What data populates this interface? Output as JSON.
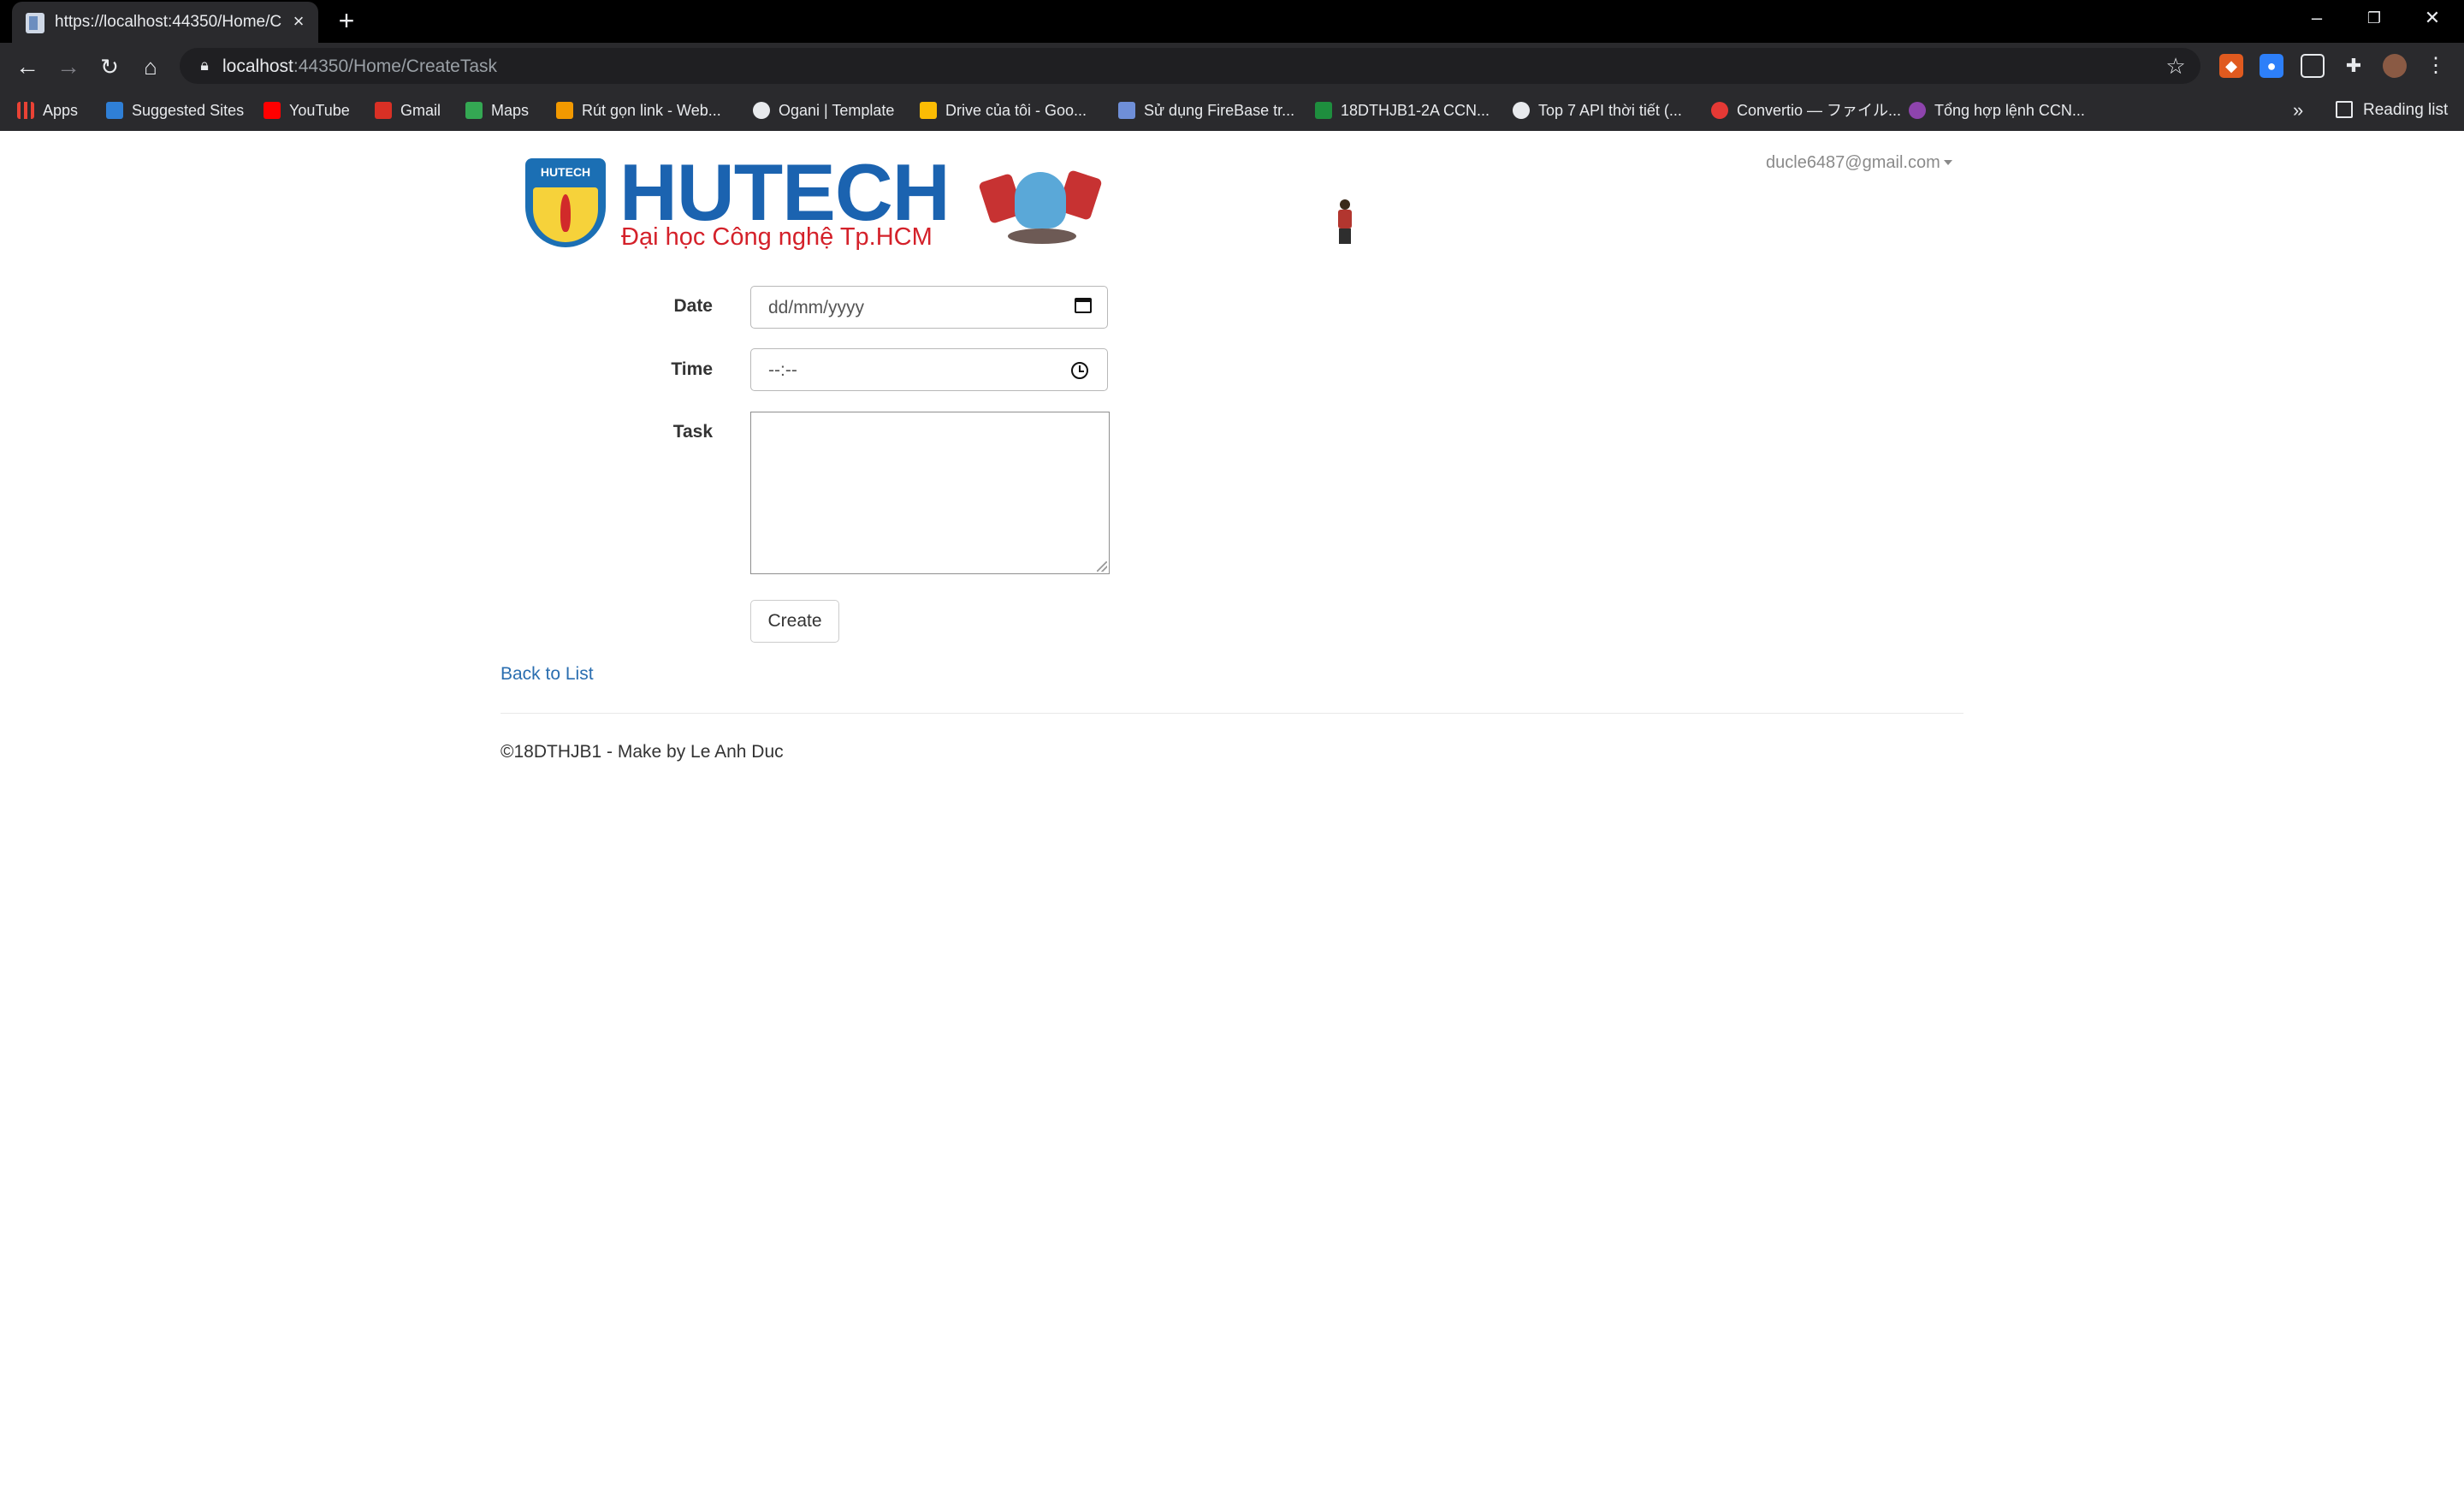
{
  "browser": {
    "tab_title": "https://localhost:44350/Home/C",
    "url_host": "localhost",
    "url_rest": ":44350/Home/CreateTask",
    "bookmarks": [
      {
        "label": "Apps",
        "icon": "apps-grid-icon",
        "color": "#e94235"
      },
      {
        "label": "Suggested Sites",
        "icon": "bing-icon",
        "color": "#2f7fd6"
      },
      {
        "label": "YouTube",
        "icon": "youtube-icon",
        "color": "#ff0000"
      },
      {
        "label": "Gmail",
        "icon": "gmail-icon",
        "color": "#d93025"
      },
      {
        "label": "Maps",
        "icon": "maps-icon",
        "color": "#34a853"
      },
      {
        "label": "Rút gọn link - Web...",
        "icon": "v-shield-icon",
        "color": "#f29900"
      },
      {
        "label": "Ogani | Template",
        "icon": "globe-icon",
        "color": "#e8eaed"
      },
      {
        "label": "Drive của tôi - Goo...",
        "icon": "drive-icon",
        "color": "#fbbc04"
      },
      {
        "label": "Sử dụng FireBase tr...",
        "icon": "y-icon",
        "color": "#6f8fd8"
      },
      {
        "label": "18DTHJB1-2A CCN...",
        "icon": "classroom-icon",
        "color": "#1e8e3e"
      },
      {
        "label": "Top 7 API thời tiết (...",
        "icon": "clock-logo-icon",
        "color": "#e8eaed"
      },
      {
        "label": "Convertio — ファイル...",
        "icon": "convertio-icon",
        "color": "#e53935"
      },
      {
        "label": "Tổng hợp lệnh CCN...",
        "icon": "purple-circle-icon",
        "color": "#8e44ad"
      }
    ],
    "more_label": "»",
    "reading_list_label": "Reading list"
  },
  "header": {
    "brand_shield_text": "HUTECH",
    "brand_name": "HUTECH",
    "brand_subtitle": "Đại học Công nghệ Tp.HCM",
    "user_email": "ducle6487@gmail.com"
  },
  "form": {
    "date_label": "Date",
    "date_placeholder": "dd/mm/yyyy",
    "time_label": "Time",
    "time_placeholder": "--:--",
    "task_label": "Task",
    "create_button": "Create"
  },
  "back_link": "Back to List",
  "footer_text": "©18DTHJB1 - Make by Le Anh Duc"
}
